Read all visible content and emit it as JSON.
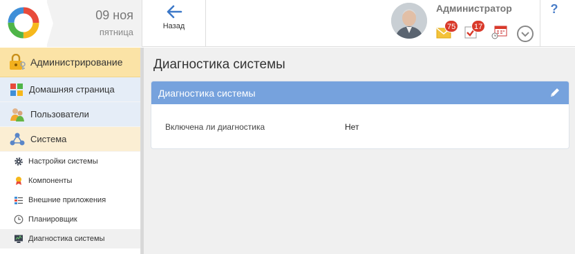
{
  "header": {
    "date_day": "09 ноя",
    "date_weekday": "пятница",
    "back_label": "Назад",
    "user_name": "Администратор",
    "messages_count": "75",
    "tasks_count": "17",
    "help_label": "?"
  },
  "sidebar": {
    "admin_label": "Администрирование",
    "items": [
      {
        "label": "Домашняя страница",
        "icon": "home-tiles-icon"
      },
      {
        "label": "Пользователи",
        "icon": "users-icon"
      },
      {
        "label": "Система",
        "icon": "system-nodes-icon"
      }
    ],
    "subitems": [
      {
        "label": "Настройки системы",
        "icon": "gear-icon"
      },
      {
        "label": "Компоненты",
        "icon": "components-medal-icon"
      },
      {
        "label": "Внешние приложения",
        "icon": "external-apps-icon"
      },
      {
        "label": "Планировщик",
        "icon": "clock-icon"
      },
      {
        "label": "Диагностика системы",
        "icon": "monitor-icon"
      }
    ]
  },
  "main": {
    "page_title": "Диагностика системы",
    "panel_title": "Диагностика системы",
    "field_label": "Включена ли диагностика",
    "field_value": "Нет"
  },
  "colors": {
    "panel_header": "#76a2dd",
    "admin_nav": "#fbe3a6",
    "badge": "#d93a2b",
    "accent_blue": "#4a7ec8"
  }
}
